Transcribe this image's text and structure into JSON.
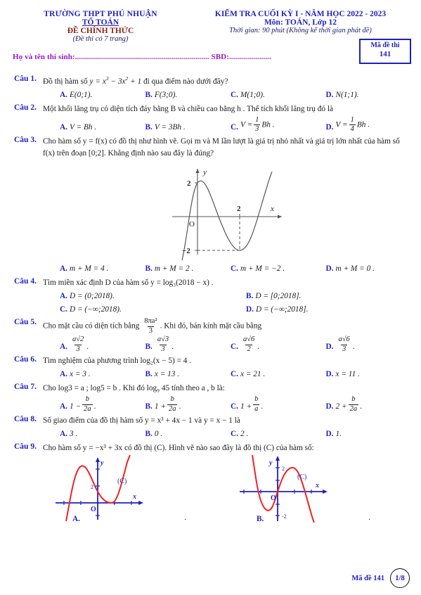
{
  "header": {
    "school": "TRƯỜNG THPT PHÚ NHUẬN",
    "dept": "TỔ TOÁN",
    "official": "ĐỀ CHÍNH THỨC",
    "pages_note": "(Đề thi có 7 trang)",
    "exam_title": "KIỂM TRA CUỐI KỲ I - NĂM HỌC 2022 - 2023",
    "subject": "Môn: TOÁN, Lớp 12",
    "duration": "Thời gian: 90 phút (Không kể thời gian phát đề)",
    "candidate_line": "Họ và tên thí sinh:................................................................... SBD:.....................",
    "code_label": "Mã đề thi",
    "code_value": "141"
  },
  "questions": [
    {
      "num": "Câu 1.",
      "stem_pre": "Đồ thị hàm số ",
      "stem_math": "y = x³ − 3x² + 1",
      "stem_post": " đi qua điểm nào dưới đây?",
      "options": [
        {
          "label": "A.",
          "text": "E(0;1)."
        },
        {
          "label": "B.",
          "text": "F(3;0)."
        },
        {
          "label": "C.",
          "text": "M(1;0)."
        },
        {
          "label": "D.",
          "text": "N(1;1)."
        }
      ]
    },
    {
      "num": "Câu 2.",
      "stem": "Một khối lăng trụ có diện tích đáy bằng B và chiều cao bằng h . Thể tích khối lăng trụ đó là",
      "options": [
        {
          "label": "A.",
          "text": "V = Bh ."
        },
        {
          "label": "B.",
          "text": "V = 3Bh ."
        },
        {
          "label": "C.",
          "text": "V = (1/3)Bh ."
        },
        {
          "label": "D.",
          "text": "V = (1/4)Bh ."
        }
      ]
    },
    {
      "num": "Câu 3.",
      "stem": "Cho hàm số y = f(x) có đồ thị như hình vẽ. Gọi m và M lần lượt là giá trị nhỏ nhất và giá trị lớn nhất của hàm số f(x) trên đoạn [0;2]. Khẳng định nào sau đây là đúng?",
      "emphasis": "đúng",
      "options": [
        {
          "label": "A.",
          "text": "m + M = 4 ."
        },
        {
          "label": "B.",
          "text": "m + M = 2 ."
        },
        {
          "label": "C.",
          "text": "m + M = −2 ."
        },
        {
          "label": "D.",
          "text": "m + M = 0 ."
        }
      ],
      "figure": {
        "type": "cubic-graph",
        "axis_labels": {
          "x": "x",
          "y": "y",
          "origin": "O"
        },
        "ticks": {
          "y_positive": "2",
          "y_negative": "−2",
          "x_positive": "2"
        },
        "description": "Đồ thị hàm bậc ba, cực đại (0;2), cực tiểu (2;−2)"
      }
    },
    {
      "num": "Câu 4.",
      "stem": "Tìm miền xác định D của hàm số y = log₃(2018 − x) .",
      "options": [
        {
          "label": "A.",
          "text": "D = (0;2018)."
        },
        {
          "label": "B.",
          "text": "D = [0;2018]."
        },
        {
          "label": "C.",
          "text": "D = (−∞;2018)."
        },
        {
          "label": "D.",
          "text": "D = (−∞;2018]."
        }
      ]
    },
    {
      "num": "Câu 5.",
      "stem_pre": "Cho mặt cầu có diện tích bằng ",
      "stem_frac_num": "8πa²",
      "stem_frac_den": "3",
      "stem_post": ". Khi đó, bán kính mặt cầu bằng",
      "options": [
        {
          "label": "A.",
          "num": "a√2",
          "den": "3"
        },
        {
          "label": "B.",
          "num": "a√3",
          "den": "3"
        },
        {
          "label": "C.",
          "num": "a√6",
          "den": "2"
        },
        {
          "label": "D.",
          "num": "a√6",
          "den": "3"
        }
      ]
    },
    {
      "num": "Câu 6.",
      "stem": "Tìm nghiệm của phương trình log₂(x − 5) = 4 .",
      "options": [
        {
          "label": "A.",
          "text": "x = 3 ."
        },
        {
          "label": "B.",
          "text": "x = 13 ."
        },
        {
          "label": "C.",
          "text": "x = 21 ."
        },
        {
          "label": "D.",
          "text": "x = 11 ."
        }
      ]
    },
    {
      "num": "Câu 7.",
      "stem": "Cho log3 = a ; log5 = b . Khi đó log₉ 45 tính theo a , b là:",
      "options": [
        {
          "label": "A.",
          "lead": "1 −",
          "num": "b",
          "den": "2a"
        },
        {
          "label": "B.",
          "lead": "1 +",
          "num": "b",
          "den": "2a"
        },
        {
          "label": "C.",
          "lead": "1 +",
          "num": "b",
          "den": "a"
        },
        {
          "label": "D.",
          "lead": "2 +",
          "num": "b",
          "den": "2a"
        }
      ]
    },
    {
      "num": "Câu 8.",
      "stem": "Số giao điểm của đồ thị hàm số y = x³ + 4x − 1 và y = x − 1 là",
      "options": [
        {
          "label": "A.",
          "text": "3 ."
        },
        {
          "label": "B.",
          "text": "0 ."
        },
        {
          "label": "C.",
          "text": "2 ."
        },
        {
          "label": "D.",
          "text": "1."
        }
      ]
    },
    {
      "num": "Câu 9.",
      "stem": "Cho hàm số y = −x³ + 3x có đồ thị (C). Hình vẽ nào sao đây là đồ thị (C) của hàm số:",
      "options": [
        {
          "label": "A.",
          "text": "."
        },
        {
          "label": "B.",
          "text": "."
        }
      ],
      "figures": [
        {
          "id": "A",
          "curve_label": "(C)",
          "axis_labels": {
            "x": "x",
            "y": "y",
            "origin": "O"
          },
          "ticks": {
            "y": "2"
          },
          "description": "Đồ thị bậc ba tăng, cực đại bên trái trục tung, cực tiểu chạm trục hoành"
        },
        {
          "id": "B",
          "curve_label": "(C)",
          "axis_labels": {
            "x": "x",
            "y": "y",
            "origin": "O"
          },
          "ticks": {
            "y_positive": "2",
            "y_negative": "-2"
          },
          "description": "Đồ thị y = −x³ + 3x, cực tiểu (−1;−2), cực đại (1;2)"
        }
      ]
    }
  ],
  "footer": {
    "code_text": "Mã đề 141",
    "page": "1/8"
  },
  "colors": {
    "blue": "#1f1fbf",
    "maroon": "#8c1f12",
    "purple": "#9a18c9",
    "red_curve": "#ee2222"
  }
}
